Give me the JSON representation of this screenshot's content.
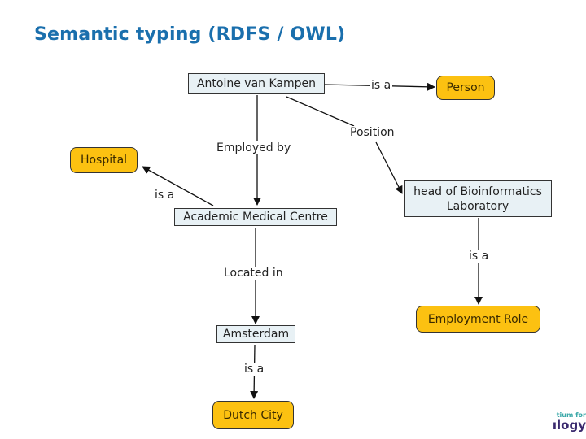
{
  "slide": {
    "title": "Semantic typing (RDFS / OWL)"
  },
  "nodes": {
    "antoine": "Antoine van Kampen",
    "person": "Person",
    "hospital": "Hospital",
    "amc": "Academic Medical Centre",
    "head_line1": "head of Bioinformatics",
    "head_line2": "Laboratory",
    "employment_role": "Employment Role",
    "amsterdam": "Amsterdam",
    "dutch_city": "Dutch City"
  },
  "links": {
    "antoine_person": "is a",
    "position": "Position",
    "employed_by": "Employed by",
    "amc_hospital": "is a",
    "head_role": "is a",
    "located_in": "Located in",
    "amsterdam_city": "is a"
  },
  "colors": {
    "title": "#1a6fad",
    "class_fill": "#fcc111",
    "instance_fill": "#e8f1f5"
  },
  "logo": {
    "line1": "tium for",
    "line2": "ılogy"
  }
}
